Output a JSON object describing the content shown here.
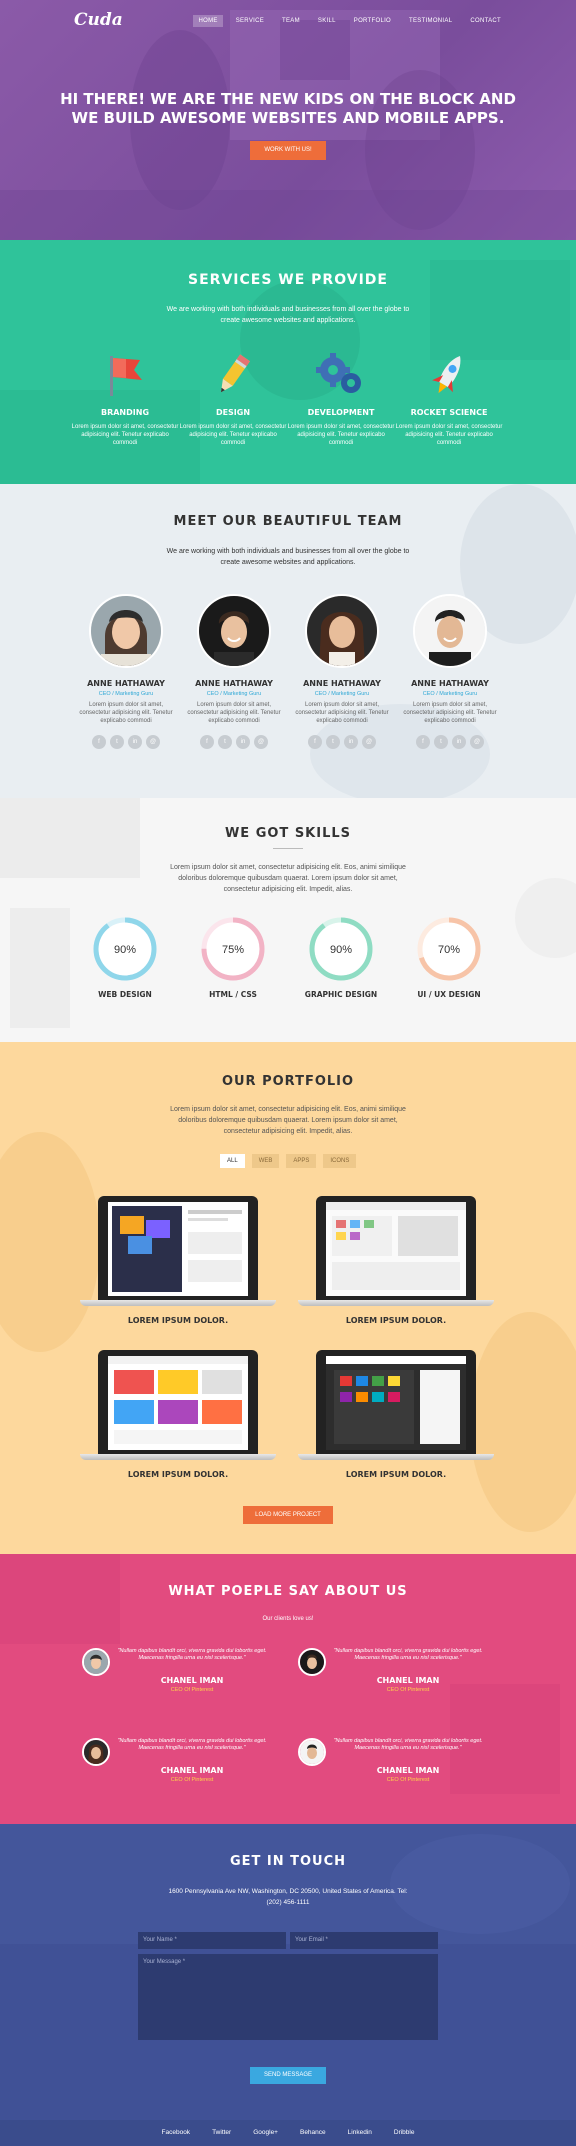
{
  "nav": {
    "logo": "Cuda",
    "items": [
      "HOME",
      "SERVICE",
      "TEAM",
      "SKILL",
      "PORTFOLIO",
      "TESTIMONIAL",
      "CONTACT"
    ]
  },
  "hero": {
    "title": "HI THERE! WE ARE THE NEW KIDS ON THE BLOCK AND WE BUILD AWESOME WEBSITES AND MOBILE APPS.",
    "button": "WORK WITH US!"
  },
  "services": {
    "title": "SERVICES WE PROVIDE",
    "intro": "We are working with both individuals and businesses from all over the globe to create awesome websites and applications.",
    "items": [
      {
        "title": "BRANDING",
        "text": "Lorem ipsum dolor sit amet, consectetur adipisicing elit. Tenetur explicabo commodi",
        "icon": "flag-icon"
      },
      {
        "title": "DESIGN",
        "text": "Lorem ipsum dolor sit amet, consectetur adipisicing elit. Tenetur explicabo commodi",
        "icon": "pencil-icon"
      },
      {
        "title": "DEVELOPMENT",
        "text": "Lorem ipsum dolor sit amet, consectetur adipisicing elit. Tenetur explicabo commodi",
        "icon": "gears-icon"
      },
      {
        "title": "ROCKET SCIENCE",
        "text": "Lorem ipsum dolor sit amet, consectetur adipisicing elit. Tenetur explicabo commodi",
        "icon": "rocket-icon"
      }
    ]
  },
  "team": {
    "title": "MEET OUR BEAUTIFUL TEAM",
    "intro": "We are working with both individuals and businesses from all over the globe to create awesome websites and applications.",
    "members": [
      {
        "name": "ANNE HATHAWAY",
        "role": "CEO / Marketing Guru",
        "text": "Lorem ipsum dolor sit amet, consectetur adipisicing elit. Tenetur explicabo commodi"
      },
      {
        "name": "ANNE HATHAWAY",
        "role": "CEO / Marketing Guru",
        "text": "Lorem ipsum dolor sit amet, consectetur adipisicing elit. Tenetur explicabo commodi"
      },
      {
        "name": "ANNE HATHAWAY",
        "role": "CEO / Marketing Guru",
        "text": "Lorem ipsum dolor sit amet, consectetur adipisicing elit. Tenetur explicabo commodi"
      },
      {
        "name": "ANNE HATHAWAY",
        "role": "CEO / Marketing Guru",
        "text": "Lorem ipsum dolor sit amet, consectetur adipisicing elit. Tenetur explicabo commodi"
      }
    ],
    "social_icons": [
      "f",
      "t",
      "in",
      "@"
    ]
  },
  "skills": {
    "title": "WE GOT SKILLS",
    "intro": "Lorem ipsum dolor sit amet, consectetur adipisicing elit. Eos, animi similique doloribus doloremque quibusdam quaerat. Lorem ipsum dolor sit amet, consectetur adipisicing elit. Impedit, alias.",
    "items": [
      {
        "label": "WEB DESIGN",
        "value": 90,
        "text": "90%",
        "color": "#8fd6ea"
      },
      {
        "label": "HTML / CSS",
        "value": 75,
        "text": "75%",
        "color": "#f2b3c5"
      },
      {
        "label": "GRAPHIC DESIGN",
        "value": 90,
        "text": "90%",
        "color": "#8fdcc3"
      },
      {
        "label": "UI / UX DESIGN",
        "value": 70,
        "text": "70%",
        "color": "#f7c4a8"
      }
    ]
  },
  "portfolio": {
    "title": "OUR PORTFOLIO",
    "intro": "Lorem ipsum dolor sit amet, consectetur adipisicing elit. Eos, animi similique doloribus doloremque quibusdam quaerat. Lorem ipsum dolor sit amet, consectetur adipisicing elit. Impedit, alias.",
    "filters": [
      "ALL",
      "WEB",
      "APPS",
      "ICONS"
    ],
    "items": [
      "LOREM IPSUM DOLOR.",
      "LOREM IPSUM DOLOR.",
      "LOREM IPSUM DOLOR.",
      "LOREM IPSUM DOLOR."
    ],
    "button": "LOAD MORE PROJECT"
  },
  "testimonials": {
    "title": "WHAT POEPLE SAY ABOUT US",
    "subtitle": "Our clients love us!",
    "items": [
      {
        "quote": "\"Nullam dapibus blandit orci, viverra gravida dui lobortis eget. Maecenas fringilla urna eu nisl scelerisque.\"",
        "name": "CHANEL IMAN",
        "role": "CEO Of Pinterest"
      },
      {
        "quote": "\"Nullam dapibus blandit orci, viverra gravida dui lobortis eget. Maecenas fringilla urna eu nisl scelerisque.\"",
        "name": "CHANEL IMAN",
        "role": "CEO Of Pinterest"
      },
      {
        "quote": "\"Nullam dapibus blandit orci, viverra gravida dui lobortis eget. Maecenas fringilla urna eu nisl scelerisque.\"",
        "name": "CHANEL IMAN",
        "role": "CEO Of Pinterest"
      },
      {
        "quote": "\"Nullam dapibus blandit orci, viverra gravida dui lobortis eget. Maecenas fringilla urna eu nisl scelerisque.\"",
        "name": "CHANEL IMAN",
        "role": "CEO Of Pinterest"
      }
    ]
  },
  "contact": {
    "title": "GET IN TOUCH",
    "address": "1600 Pennsylvania Ave NW, Washington, DC 20500, United States of America. Tel: (202) 456-1111",
    "name_placeholder": "Your Name *",
    "email_placeholder": "Your Email *",
    "message_placeholder": "Your Message *",
    "button": "SEND MESSAGE"
  },
  "footer": {
    "links": [
      "Facebook",
      "Twitter",
      "Google+",
      "Behance",
      "Linkedin",
      "Dribble"
    ]
  }
}
